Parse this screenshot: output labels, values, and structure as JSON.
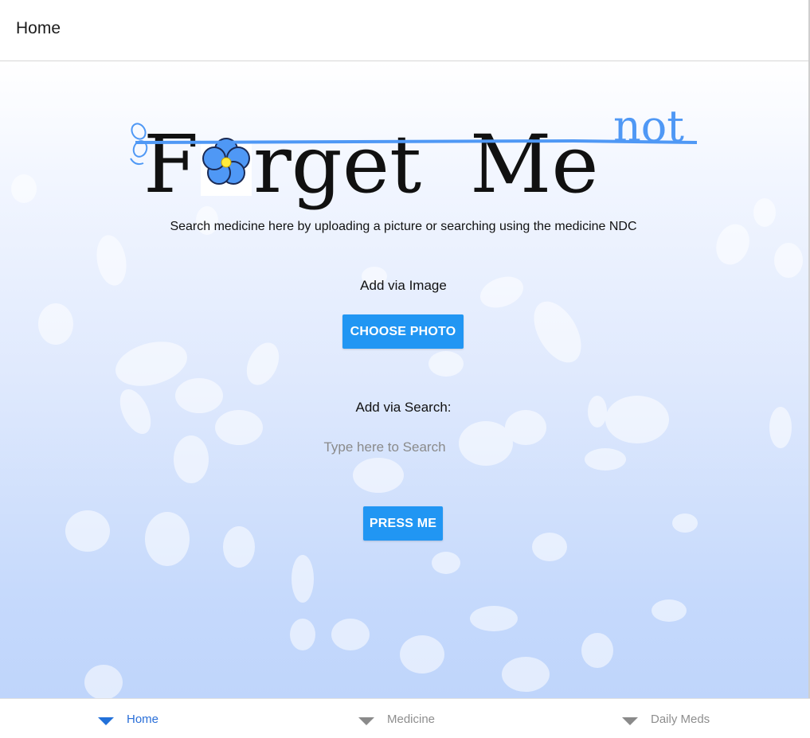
{
  "header": {
    "title": "Home"
  },
  "logo": {
    "word_forget": "F",
    "word_rget": "rget",
    "word_me": "Me",
    "word_not": "not"
  },
  "main": {
    "tagline": "Search medicine here by uploading a picture or searching using the medicine NDC",
    "image_label": "Add via Image",
    "choose_photo_label": "CHOOSE PHOTO",
    "search_label": "Add via Search:",
    "search_placeholder": "Type here to Search",
    "search_value": "",
    "press_label": "PRESS ME"
  },
  "tabs": [
    {
      "label": "Home",
      "active": true,
      "icon": "triangle-down-icon"
    },
    {
      "label": "Medicine",
      "active": false,
      "icon": "triangle-down-icon"
    },
    {
      "label": "Daily Meds",
      "active": false,
      "icon": "triangle-down-icon"
    }
  ],
  "colors": {
    "accent": "#2196f3",
    "active_tab": "#2a6fd8",
    "inactive_tab": "#8e8e8e",
    "logo_blue": "#4f98f5"
  }
}
